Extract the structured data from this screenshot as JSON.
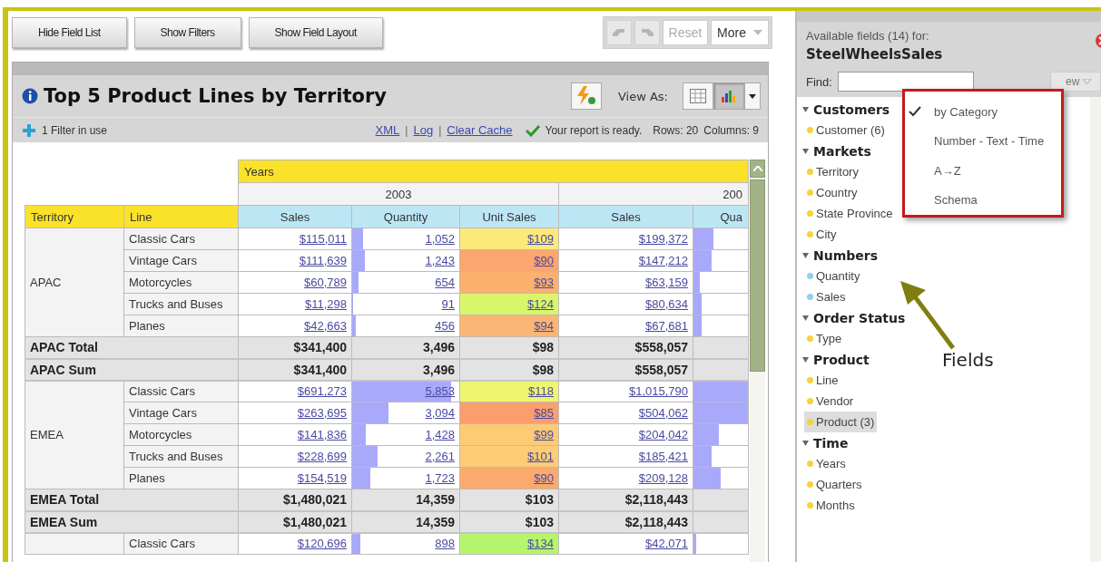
{
  "toolbar": {
    "buttons": [
      {
        "label": "Hide Field List"
      },
      {
        "label": "Show Filters"
      },
      {
        "label": "Show Field Layout"
      }
    ],
    "history": {
      "undo_disabled": true,
      "redo_disabled": true
    },
    "reset": {
      "label": "Reset",
      "disabled": true
    },
    "more": {
      "label": "More"
    }
  },
  "report": {
    "title": "Top 5 Product Lines by Territory",
    "view_as_label": "View As:",
    "view_modes": [
      {
        "kind": "table",
        "selected": false
      },
      {
        "kind": "chart",
        "selected": true
      }
    ],
    "filter_text": "1 Filter in use",
    "links": [
      {
        "kind": "link",
        "text": "XML"
      },
      {
        "kind": "separator",
        "text": "|"
      },
      {
        "kind": "link",
        "text": "Log"
      },
      {
        "kind": "separator",
        "text": "|"
      },
      {
        "kind": "link",
        "text": "Clear Cache"
      }
    ],
    "status": "Your report is ready.",
    "rows": "Rows: 20",
    "columns": "Columns: 9",
    "table": {
      "years_label": "Years",
      "years": [
        "2003",
        "200"
      ],
      "row_headers": [
        "Territory",
        "Line"
      ],
      "measures": [
        "Sales",
        "Quantity",
        "Unit Sales",
        "Sales",
        "Qua"
      ],
      "groups": [
        {
          "territory": "APAC",
          "lines": [
            {
              "line": "Classic Cars",
              "sales03": "$115,011",
              "qty03": {
                "text": "1,052",
                "level": 0.1
              },
              "unit03": {
                "text": "$109",
                "color": "#fde97a"
              },
              "sales04": "$199,372",
              "qty04": {
                "level": 0.36
              }
            },
            {
              "line": "Vintage Cars",
              "sales03": "$111,639",
              "qty03": {
                "text": "1,243",
                "level": 0.12
              },
              "unit03": {
                "text": "$90",
                "color": "#fba66e"
              },
              "sales04": "$147,212",
              "qty04": {
                "level": 0.33
              }
            },
            {
              "line": "Motorcycles",
              "sales03": "$60,789",
              "qty03": {
                "text": "654",
                "level": 0.06
              },
              "unit03": {
                "text": "$93",
                "color": "#fbb06e"
              },
              "sales04": "$63,159",
              "qty04": {
                "level": 0.11
              }
            },
            {
              "line": "Trucks and Buses",
              "sales03": "$11,298",
              "qty03": {
                "text": "91",
                "level": 0.01
              },
              "unit03": {
                "text": "$124",
                "color": "#d9f56b"
              },
              "sales04": "$80,634",
              "qty04": {
                "level": 0.15
              }
            },
            {
              "line": "Planes",
              "sales03": "$42,663",
              "qty03": {
                "text": "456",
                "level": 0.03
              },
              "unit03": {
                "text": "$94",
                "color": "#fbb574"
              },
              "sales04": "$67,681",
              "qty04": {
                "level": 0.15
              }
            }
          ],
          "totals": [
            {
              "label": "APAC Total",
              "sales03": "$341,400",
              "qty03": "3,496",
              "unit03": "$98",
              "sales04": "$558,057"
            },
            {
              "label": "APAC Sum",
              "sales03": "$341,400",
              "qty03": "3,496",
              "unit03": "$98",
              "sales04": "$558,057"
            }
          ]
        },
        {
          "territory": "EMEA",
          "lines": [
            {
              "line": "Classic Cars",
              "sales03": "$691,273",
              "qty03": {
                "text": "5,853",
                "level": 0.92
              },
              "unit03": {
                "text": "$118",
                "color": "#eef56f"
              },
              "sales04": "$1,015,790",
              "qty04": {
                "level": 1
              }
            },
            {
              "line": "Vintage Cars",
              "sales03": "$263,695",
              "qty03": {
                "text": "3,094",
                "level": 0.34
              },
              "unit03": {
                "text": "$85",
                "color": "#fb9e6e"
              },
              "sales04": "$504,062",
              "qty04": {
                "level": 1
              }
            },
            {
              "line": "Motorcycles",
              "sales03": "$141,836",
              "qty03": {
                "text": "1,428",
                "level": 0.13
              },
              "unit03": {
                "text": "$99",
                "color": "#fccb74"
              },
              "sales04": "$204,042",
              "qty04": {
                "level": 0.46
              }
            },
            {
              "line": "Trucks and Buses",
              "sales03": "$228,699",
              "qty03": {
                "text": "2,261",
                "level": 0.24
              },
              "unit03": {
                "text": "$101",
                "color": "#fccd74"
              },
              "sales04": "$185,421",
              "qty04": {
                "level": 0.33
              }
            },
            {
              "line": "Planes",
              "sales03": "$154,519",
              "qty03": {
                "text": "1,723",
                "level": 0.17
              },
              "unit03": {
                "text": "$90",
                "color": "#fbaa6e"
              },
              "sales04": "$209,128",
              "qty04": {
                "level": 0.5
              }
            }
          ],
          "totals": [
            {
              "label": "EMEA Total",
              "sales03": "$1,480,021",
              "qty03": "14,359",
              "unit03": "$103",
              "sales04": "$2,118,443"
            },
            {
              "label": "EMEA Sum",
              "sales03": "$1,480,021",
              "qty03": "14,359",
              "unit03": "$103",
              "sales04": "$2,118,443"
            }
          ]
        },
        {
          "lines": [
            {
              "line": "Classic Cars",
              "sales03": "$120,696",
              "qty03": {
                "text": "898",
                "level": 0.08
              },
              "unit03": {
                "text": "$134",
                "color": "#b6f56b"
              },
              "sales04": "$42,071",
              "qty04": {
                "level": 0.05
              }
            }
          ]
        }
      ]
    }
  },
  "field_panel": {
    "heading": "Available fields (14) for:",
    "model": "SteelWheelsSales",
    "find_label": "Find:",
    "view_button": "ew",
    "categories": [
      {
        "name": "Customers",
        "expanded": true,
        "children": [
          {
            "name": "Customer (6)",
            "color": "#f7d23a",
            "selected": false
          }
        ]
      },
      {
        "name": "Markets",
        "expanded": true,
        "children": [
          {
            "name": "Territory",
            "color": "#f7d23a",
            "selected": false
          },
          {
            "name": "Country",
            "color": "#f7d23a",
            "selected": false
          },
          {
            "name": "State Province",
            "color": "#f7d23a",
            "selected": false
          },
          {
            "name": "City",
            "color": "#f7d23a",
            "selected": false
          }
        ]
      },
      {
        "name": "Numbers",
        "expanded": true,
        "children": [
          {
            "name": "Quantity",
            "color": "#8fd0ea",
            "selected": false
          },
          {
            "name": "Sales",
            "color": "#8fd0ea",
            "selected": false
          }
        ]
      },
      {
        "name": "Order Status",
        "expanded": true,
        "children": [
          {
            "name": "Type",
            "color": "#f7d23a",
            "selected": false
          }
        ]
      },
      {
        "name": "Product",
        "expanded": true,
        "children": [
          {
            "name": "Line",
            "color": "#f7d23a",
            "selected": false
          },
          {
            "name": "Vendor",
            "color": "#f7d23a",
            "selected": false
          },
          {
            "name": "Product (3)",
            "color": "#f7d23a",
            "selected": true
          }
        ]
      },
      {
        "name": "Time",
        "expanded": true,
        "children": [
          {
            "name": "Years",
            "color": "#f7d23a",
            "selected": false
          },
          {
            "name": "Quarters",
            "color": "#f7d23a",
            "selected": false
          },
          {
            "name": "Months",
            "color": "#f7d23a",
            "selected": false
          }
        ]
      }
    ],
    "view_menu": [
      {
        "label": "by Category",
        "selected": true
      },
      {
        "label": "Number - Text - Time",
        "selected": false
      },
      {
        "label": "A→Z",
        "selected": false
      },
      {
        "label": "Schema",
        "selected": false
      }
    ]
  },
  "annotation": {
    "label": "Fields"
  }
}
